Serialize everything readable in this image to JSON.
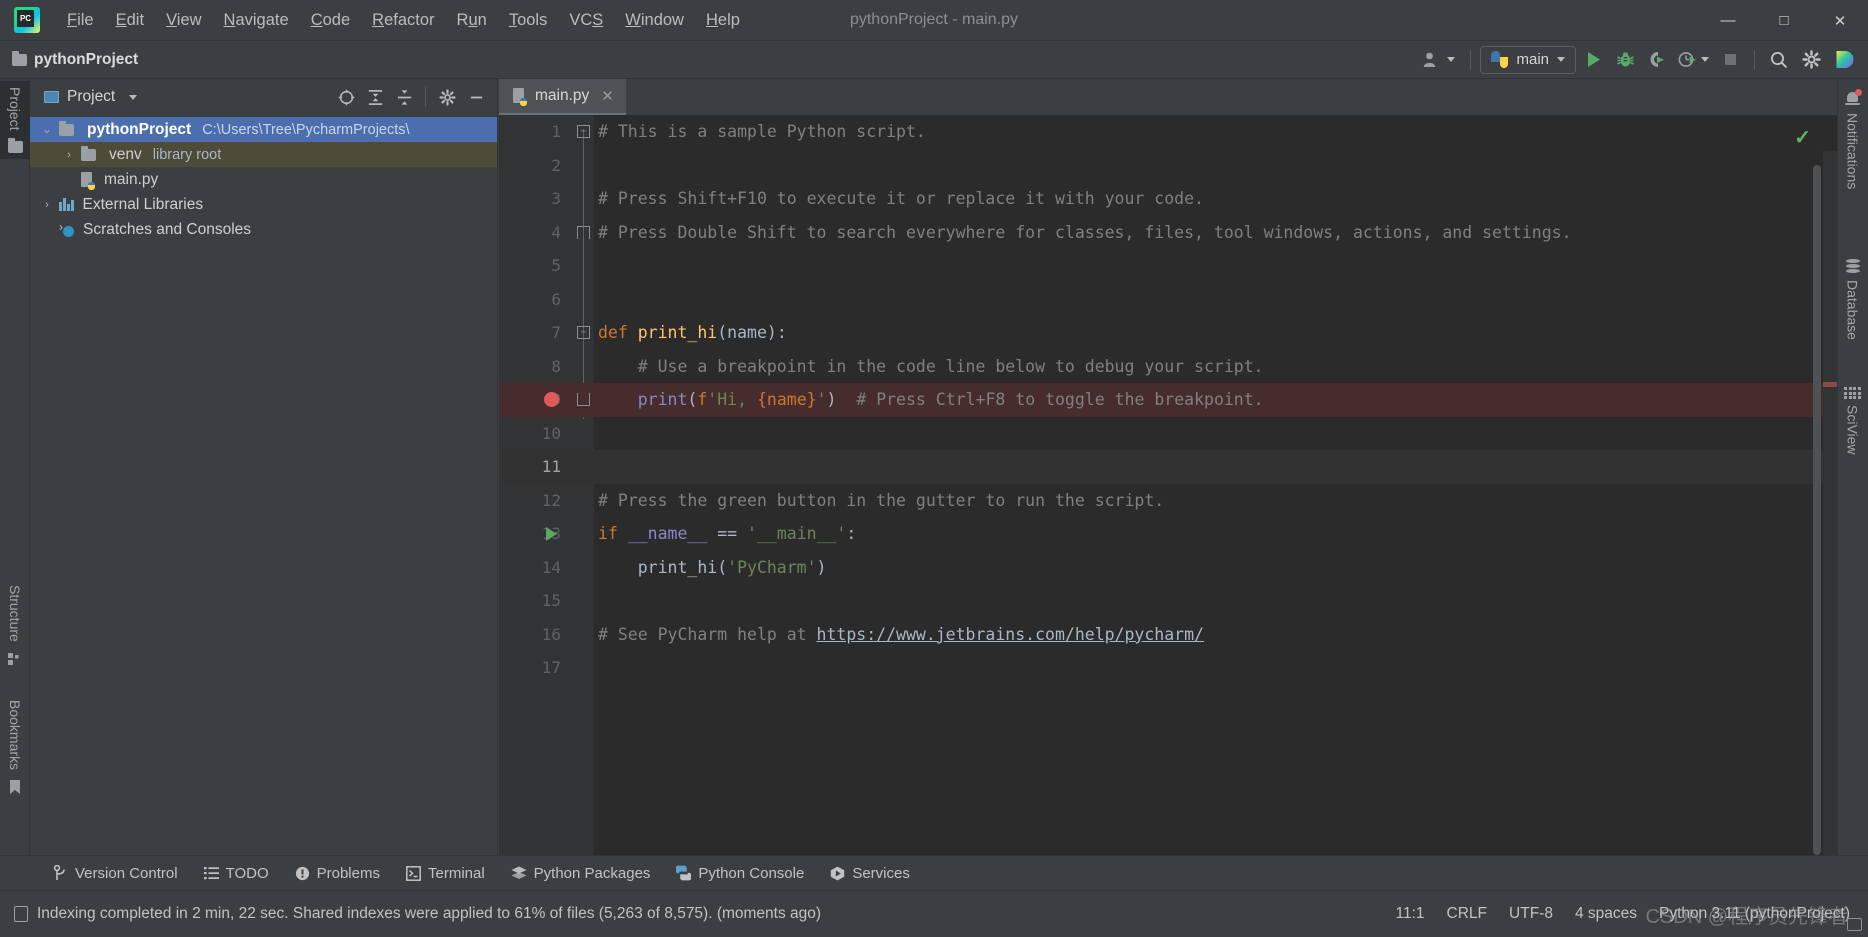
{
  "window": {
    "title": "pythonProject - main.py",
    "logo_icon": "pycharm-logo-icon",
    "minimize": "—",
    "maximize": "□",
    "close": "✕"
  },
  "menu": [
    {
      "label": "File",
      "mnemonic": "F"
    },
    {
      "label": "Edit",
      "mnemonic": "E"
    },
    {
      "label": "View",
      "mnemonic": "V"
    },
    {
      "label": "Navigate",
      "mnemonic": "N"
    },
    {
      "label": "Code",
      "mnemonic": "C"
    },
    {
      "label": "Refactor",
      "mnemonic": "R"
    },
    {
      "label": "Run",
      "mnemonic": "u"
    },
    {
      "label": "Tools",
      "mnemonic": "T"
    },
    {
      "label": "VCS",
      "mnemonic": "S"
    },
    {
      "label": "Window",
      "mnemonic": "W"
    },
    {
      "label": "Help",
      "mnemonic": "H"
    }
  ],
  "navbar": {
    "breadcrumb": "pythonProject",
    "account_icon": "user-account-icon",
    "run_config": "main",
    "run_config_icon": "python-icon",
    "icons": [
      {
        "name": "run-icon",
        "title": "Run"
      },
      {
        "name": "debug-icon",
        "title": "Debug"
      },
      {
        "name": "run-with-coverage-icon",
        "title": "Run with Coverage"
      },
      {
        "name": "profile-icon",
        "title": "Profile"
      },
      {
        "name": "stop-icon",
        "title": "Stop"
      },
      {
        "name": "search-everywhere-icon",
        "title": "Search Everywhere"
      },
      {
        "name": "settings-gear-icon",
        "title": "Settings"
      },
      {
        "name": "ide-assistant-icon",
        "title": "Assistant"
      }
    ]
  },
  "left_stripe": [
    {
      "label": "Project",
      "icon": "folder-icon",
      "active": true
    },
    {
      "label": "Structure",
      "icon": "structure-icon",
      "active": false
    },
    {
      "label": "Bookmarks",
      "icon": "bookmark-icon",
      "active": false
    }
  ],
  "right_stripe": [
    {
      "label": "Notifications",
      "icon": "bell-icon",
      "badge": true
    },
    {
      "label": "Database",
      "icon": "database-icon",
      "badge": false
    },
    {
      "label": "SciView",
      "icon": "sciview-grid-icon",
      "badge": false
    }
  ],
  "project_panel": {
    "title": "Project",
    "view_icon": "project-view-icon",
    "dropdown_icon": "chevron-down-icon",
    "tools": [
      {
        "name": "select-opened-file-icon",
        "title": "Select Opened File"
      },
      {
        "name": "expand-all-icon",
        "title": "Expand All"
      },
      {
        "name": "collapse-all-icon",
        "title": "Collapse All"
      },
      {
        "name": "panel-settings-gear-icon",
        "title": "Settings"
      },
      {
        "name": "hide-panel-icon",
        "title": "Hide"
      }
    ],
    "tree": [
      {
        "label": "pythonProject",
        "secondary": "C:\\Users\\Tree\\PycharmProjects\\",
        "icon": "folder-icon",
        "arrow": "⌄",
        "state": "selected",
        "indent": 0
      },
      {
        "label": "venv",
        "secondary": "library root",
        "icon": "folder-icon",
        "arrow": "›",
        "state": "highlighted",
        "indent": 1
      },
      {
        "label": "main.py",
        "secondary": "",
        "icon": "python-file-icon",
        "arrow": "",
        "state": "normal",
        "indent": 1
      },
      {
        "label": "External Libraries",
        "secondary": "",
        "icon": "libraries-icon",
        "arrow": "›",
        "state": "normal",
        "indent": 0
      },
      {
        "label": "Scratches and Consoles",
        "secondary": "",
        "icon": "scratches-icon",
        "arrow": "",
        "state": "normal",
        "indent": 0
      }
    ]
  },
  "editor": {
    "tab": {
      "label": "main.py",
      "icon": "python-file-icon",
      "close": "✕"
    },
    "inspection_status": "✓",
    "lines": [
      {
        "num": "1",
        "fold": "minus",
        "gutter": "",
        "row": "normal",
        "tokens": [
          {
            "t": "# This is a sample Python script.",
            "c": "cmt"
          }
        ]
      },
      {
        "num": "2",
        "fold": "",
        "gutter": "",
        "row": "normal",
        "tokens": []
      },
      {
        "num": "3",
        "fold": "",
        "gutter": "",
        "row": "normal",
        "tokens": [
          {
            "t": "# Press Shift+F10 to execute it or replace it with your code.",
            "c": "cmt"
          }
        ]
      },
      {
        "num": "4",
        "fold": "up",
        "gutter": "",
        "row": "normal",
        "tokens": [
          {
            "t": "# Press Double Shift to search everywhere for classes, files, tool windows, actions, and settings.",
            "c": "cmt"
          }
        ]
      },
      {
        "num": "5",
        "fold": "",
        "gutter": "",
        "row": "normal",
        "tokens": []
      },
      {
        "num": "6",
        "fold": "",
        "gutter": "",
        "row": "normal",
        "tokens": []
      },
      {
        "num": "7",
        "fold": "minus",
        "gutter": "",
        "row": "normal",
        "tokens": [
          {
            "t": "def ",
            "c": "kw"
          },
          {
            "t": "print_hi",
            "c": "fn"
          },
          {
            "t": "(name):",
            "c": "brc"
          }
        ]
      },
      {
        "num": "8",
        "fold": "",
        "gutter": "",
        "row": "normal",
        "tokens": [
          {
            "t": "    # Use a breakpoint in the code line below to debug your script.",
            "c": "cmt"
          }
        ]
      },
      {
        "num": "9",
        "fold": "dn",
        "gutter": "breakpoint",
        "row": "breakpoint",
        "tokens": [
          {
            "t": "    ",
            "c": "brc"
          },
          {
            "t": "print",
            "c": "bi"
          },
          {
            "t": "(",
            "c": "brc"
          },
          {
            "t": "f",
            "c": "pfx"
          },
          {
            "t": "'Hi, ",
            "c": "str"
          },
          {
            "t": "{name}",
            "c": "itp"
          },
          {
            "t": "'",
            "c": "str"
          },
          {
            "t": ")",
            "c": "brc"
          },
          {
            "t": "  # Press Ctrl+F8 to toggle the breakpoint.",
            "c": "cmt"
          }
        ]
      },
      {
        "num": "10",
        "fold": "",
        "gutter": "",
        "row": "normal",
        "tokens": []
      },
      {
        "num": "11",
        "fold": "",
        "gutter": "",
        "row": "current",
        "tokens": []
      },
      {
        "num": "12",
        "fold": "",
        "gutter": "",
        "row": "normal",
        "tokens": [
          {
            "t": "# Press the green button in the gutter to run the script.",
            "c": "cmt"
          }
        ]
      },
      {
        "num": "13",
        "fold": "",
        "gutter": "run",
        "row": "normal",
        "tokens": [
          {
            "t": "if ",
            "c": "kw"
          },
          {
            "t": "__name__ ",
            "c": "bi"
          },
          {
            "t": "== ",
            "c": "brc"
          },
          {
            "t": "'__main__'",
            "c": "str"
          },
          {
            "t": ":",
            "c": "brc"
          }
        ]
      },
      {
        "num": "14",
        "fold": "",
        "gutter": "",
        "row": "normal",
        "tokens": [
          {
            "t": "    print_hi(",
            "c": "brc"
          },
          {
            "t": "'PyCharm'",
            "c": "str"
          },
          {
            "t": ")",
            "c": "brc"
          }
        ]
      },
      {
        "num": "15",
        "fold": "",
        "gutter": "",
        "row": "normal",
        "tokens": []
      },
      {
        "num": "16",
        "fold": "",
        "gutter": "",
        "row": "normal",
        "tokens": [
          {
            "t": "# See PyCharm help at ",
            "c": "cmt"
          },
          {
            "t": "https://www.jetbrains.com/help/pycharm/",
            "c": "link"
          }
        ]
      },
      {
        "num": "17",
        "fold": "",
        "gutter": "",
        "row": "normal",
        "tokens": []
      }
    ]
  },
  "tool_windows": [
    {
      "label": "Version Control",
      "icon": "branch-icon"
    },
    {
      "label": "TODO",
      "icon": "todo-list-icon"
    },
    {
      "label": "Problems",
      "icon": "problems-icon"
    },
    {
      "label": "Terminal",
      "icon": "terminal-icon"
    },
    {
      "label": "Python Packages",
      "icon": "packages-icon"
    },
    {
      "label": "Python Console",
      "icon": "python-console-icon"
    },
    {
      "label": "Services",
      "icon": "services-icon"
    }
  ],
  "status_bar": {
    "icon": "indexing-icon",
    "message": "Indexing completed in 2 min, 22 sec. Shared indexes were applied to 61% of files (5,263 of 8,575). (moments ago)",
    "caret": "11:1",
    "line_separator": "CRLF",
    "encoding": "UTF-8",
    "indent": "4 spaces",
    "interpreter": "Python 3.11 (pythonProject)",
    "watermark": "CSDN @程序员先锋者"
  },
  "colors": {
    "accent_blue": "#4b6eaf",
    "panel_bg": "#3c3f41",
    "editor_bg": "#2b2b2b",
    "gutter_bg": "#313335",
    "breakpoint_red": "#e05a5a",
    "run_green": "#59a869",
    "comment_gray": "#808080",
    "keyword_orange": "#cc7832",
    "string_green": "#6a8759",
    "function_yellow": "#ffc66d"
  }
}
